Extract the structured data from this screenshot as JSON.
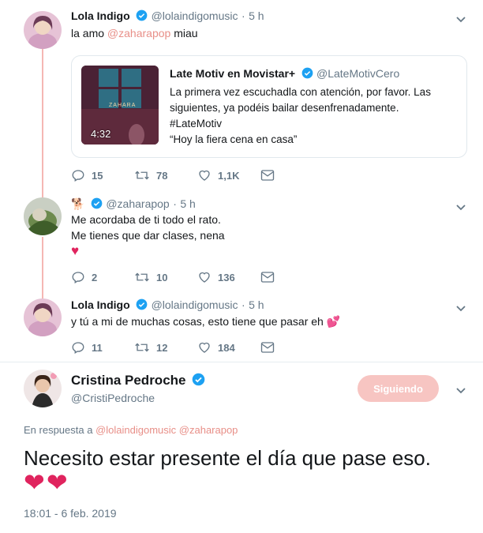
{
  "tweets": [
    {
      "name": "Lola Indigo",
      "handle": "@lolaindigomusic",
      "sep": "·",
      "time": "5 h",
      "text_plain1": "la amo ",
      "mention": "@zaharapop",
      "text_plain2": " miau",
      "quote": {
        "name": "Late Motiv en Movistar+",
        "handle": "@LateMotivCero",
        "line1": "La primera vez escuchadla con atención, por favor. Las",
        "line2": "siguientes, ya podéis bailar desenfrenadamente.",
        "line3": "#LateMotiv",
        "line4": "“Hoy la fiera cena en casa”",
        "video_duration": "4:32",
        "thumb_caption": "ZAHARA"
      },
      "replies": "15",
      "retweets": "78",
      "likes": "1,1K"
    },
    {
      "name": "",
      "name_emoji": "🐕",
      "handle": "@zaharapop",
      "sep": "·",
      "time": "5 h",
      "line1": "Me acordaba de ti todo el rato.",
      "line2": "Me tienes que dar clases, nena",
      "line3": "♥",
      "replies": "2",
      "retweets": "10",
      "likes": "136"
    },
    {
      "name": "Lola Indigo",
      "handle": "@lolaindigomusic",
      "sep": "·",
      "time": "5 h",
      "text": "y tú a mi de muchas cosas, esto tiene que pasar eh",
      "emoji": "💕",
      "replies": "11",
      "retweets": "12",
      "likes": "184"
    }
  ],
  "main": {
    "name": "Cristina Pedroche",
    "handle": "@CristiPedroche",
    "follow_label": "Siguiendo",
    "reply_prefix": "En respuesta a",
    "reply_to_1": "@lolaindigomusic",
    "reply_to_2": "@zaharapop",
    "text": "Necesito estar presente el día que pase eso.",
    "hearts": "❤❤",
    "timestamp": "18:01 - 6 feb. 2019"
  },
  "colors": {
    "accent_pink": "#e88f88",
    "verified_blue": "#1da1f2",
    "heart_red": "#e0245e",
    "meta_gray": "#657786"
  },
  "icons": [
    "verified-icon",
    "chevron-down-icon",
    "reply-icon",
    "retweet-icon",
    "like-icon",
    "dm-icon",
    "play-icon"
  ]
}
